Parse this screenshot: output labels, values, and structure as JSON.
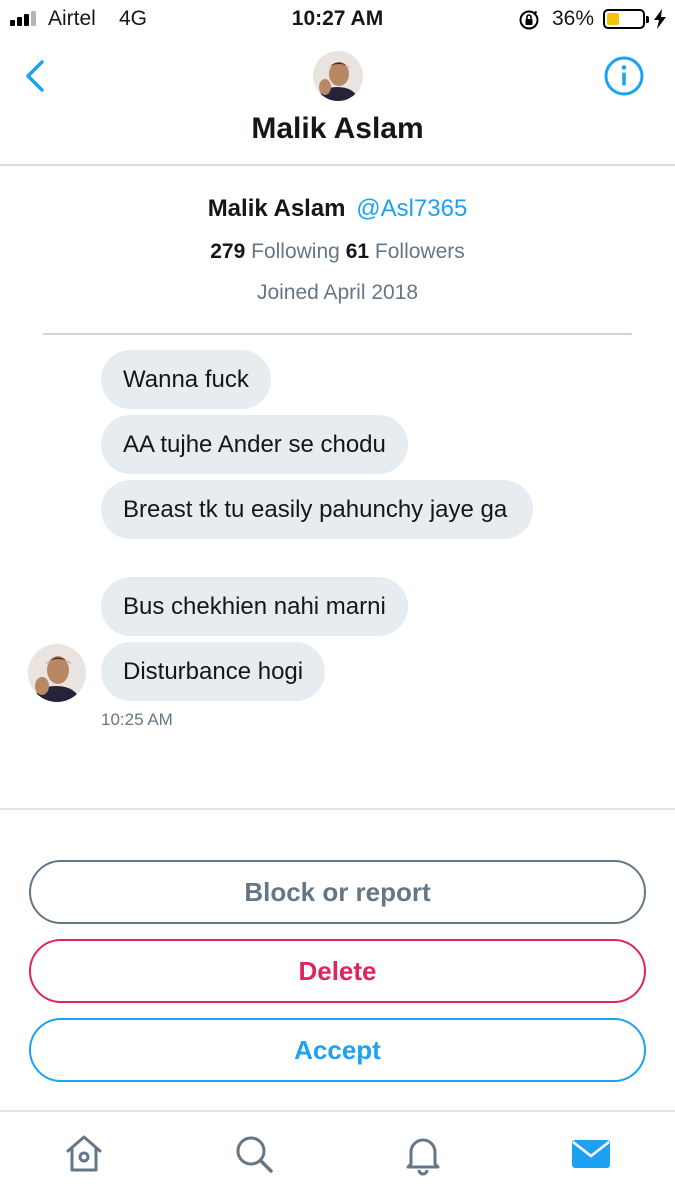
{
  "status_bar": {
    "carrier": "Airtel",
    "network": "4G",
    "time": "10:27 AM",
    "battery_percent_label": "36%",
    "battery_level": 0.36,
    "icons": [
      "signal-icon",
      "orientation-lock-icon",
      "battery-icon",
      "charging-bolt-icon"
    ]
  },
  "header": {
    "title": "Malik Aslam",
    "icons": [
      "back-chevron-icon",
      "info-icon"
    ],
    "accent_color": "#1da1f2"
  },
  "profile": {
    "name": "Malik Aslam",
    "handle": "@Asl7365",
    "following_count": "279",
    "following_label": "Following",
    "followers_count": "61",
    "followers_label": "Followers",
    "joined": "Joined April 2018"
  },
  "messages": [
    {
      "text": "Wanna fuck"
    },
    {
      "text": "AA tujhe Ander se chodu"
    },
    {
      "text": "Breast tk tu easily pahunchy jaye ga"
    },
    {
      "text": "Bus chekhien nahi marni"
    },
    {
      "text": "Disturbance hogi"
    }
  ],
  "message_time": "10:25 AM",
  "actions": {
    "block_label": "Block or report",
    "delete_label": "Delete",
    "accept_label": "Accept",
    "colors": {
      "block": "#657786",
      "delete": "#e0245e",
      "accept": "#1da1f2"
    }
  },
  "tab_bar": {
    "tabs": [
      "home-icon",
      "search-icon",
      "notifications-bell-icon",
      "messages-envelope-icon"
    ],
    "active_tab": "messages-envelope-icon"
  }
}
